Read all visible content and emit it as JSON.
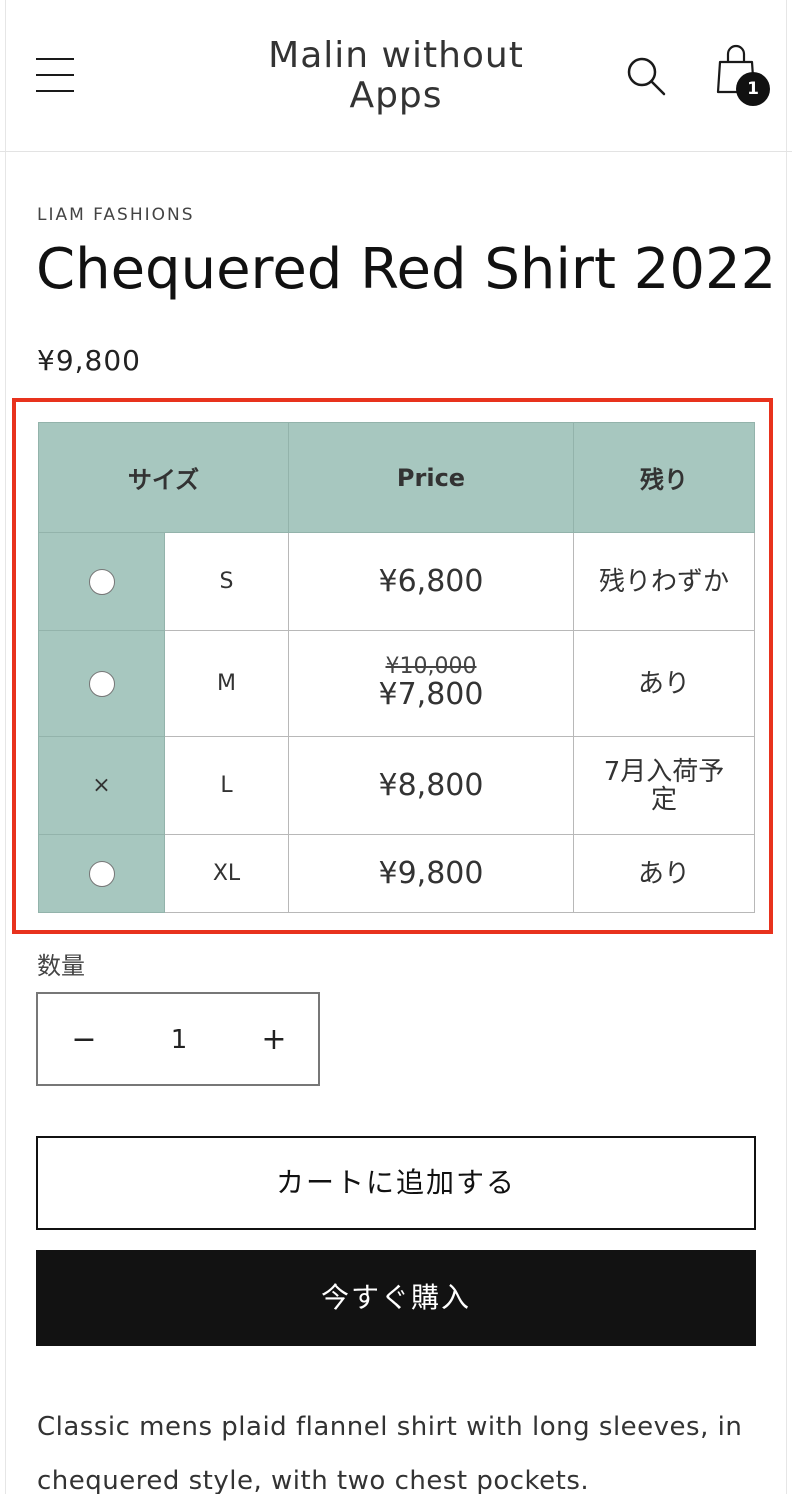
{
  "header": {
    "logo": "Malin without Apps",
    "cart_count": "1"
  },
  "product": {
    "vendor": "LIAM FASHIONS",
    "title": "Chequered Red Shirt 2022",
    "price": "¥9,800",
    "description": "Classic mens plaid flannel shirt with long sleeves, in chequered style, with two chest pockets."
  },
  "variant_table": {
    "headers": {
      "size": "サイズ",
      "price": "Price",
      "stock": "残り"
    },
    "rows": [
      {
        "selector": "radio",
        "size": "S",
        "compare_price": "",
        "price": "¥6,800",
        "stock": "残りわずか"
      },
      {
        "selector": "radio",
        "size": "M",
        "compare_price": "¥10,000",
        "price": "¥7,800",
        "stock": "あり"
      },
      {
        "selector": "×",
        "size": "L",
        "compare_price": "",
        "price": "¥8,800",
        "stock": "7月入荷予定"
      },
      {
        "selector": "radio",
        "size": "XL",
        "compare_price": "",
        "price": "¥9,800",
        "stock": "あり"
      }
    ]
  },
  "quantity": {
    "label": "数量",
    "minus": "−",
    "value": "1",
    "plus": "+"
  },
  "buttons": {
    "add_to_cart": "カートに追加する",
    "buy_now": "今すぐ購入"
  },
  "colors": {
    "table_accent": "#a7c7bf",
    "highlight_border": "#e8321d",
    "buy_button": "#121212"
  },
  "icons": {
    "menu": "hamburger-menu-icon",
    "search": "search-icon",
    "cart": "shopping-bag-icon"
  }
}
